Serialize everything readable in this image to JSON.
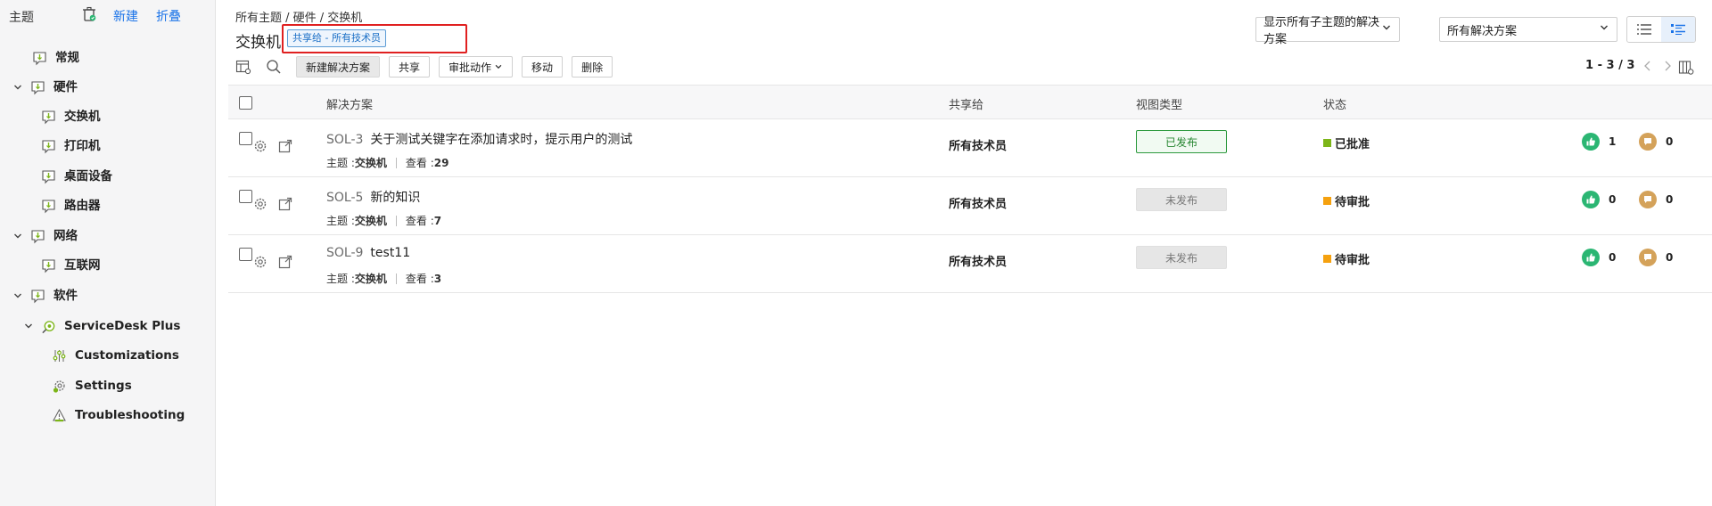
{
  "sidebar": {
    "title": "主题",
    "new_label": "新建",
    "collapse_label": "折叠",
    "items": [
      {
        "label": "常规"
      },
      {
        "label": "硬件"
      },
      {
        "label": "交换机"
      },
      {
        "label": "打印机"
      },
      {
        "label": "桌面设备"
      },
      {
        "label": "路由器"
      },
      {
        "label": "网络"
      },
      {
        "label": "互联网"
      },
      {
        "label": "软件"
      },
      {
        "label": "ServiceDesk Plus"
      },
      {
        "label": "Customizations"
      },
      {
        "label": "Settings"
      },
      {
        "label": "Troubleshooting"
      }
    ]
  },
  "header": {
    "breadcrumb": "所有主题 / 硬件 / 交换机",
    "title": "交换机",
    "shared_badge": "共享给 - 所有技术员",
    "subtopic_filter": "显示所有子主题的解决方案",
    "solution_filter": "所有解决方案"
  },
  "toolbar": {
    "new_solution": "新建解决方案",
    "share": "共享",
    "approval_actions": "审批动作",
    "move": "移动",
    "delete": "删除",
    "pagination": "1 - 3 / 3"
  },
  "table": {
    "headers": {
      "solution": "解决方案",
      "shared_with": "共享给",
      "view_type": "视图类型",
      "status": "状态"
    },
    "rows": [
      {
        "id": "SOL-3",
        "title": "关于测试关键字在添加请求时，提示用户的测试",
        "topic_label": "主题 : ",
        "topic": "交换机",
        "views_label": "查看 : ",
        "views": "29",
        "shared_with": "所有技术员",
        "view_type": "已发布",
        "status": "已批准",
        "likes": "1",
        "comments": "0"
      },
      {
        "id": "SOL-5",
        "title": "新的知识",
        "topic_label": "主题 : ",
        "topic": "交换机",
        "views_label": "查看 : ",
        "views": "7",
        "shared_with": "所有技术员",
        "view_type": "未发布",
        "status": "待审批",
        "likes": "0",
        "comments": "0"
      },
      {
        "id": "SOL-9",
        "title": "test11",
        "topic_label": "主题 : ",
        "topic": "交换机",
        "views_label": "查看 : ",
        "views": "3",
        "shared_with": "所有技术员",
        "view_type": "未发布",
        "status": "待审批",
        "likes": "0",
        "comments": "0"
      }
    ]
  },
  "colors": {
    "link_blue": "#1a73e8",
    "approved": "#7cb518",
    "pending": "#f5a10f",
    "like": "#2bb673",
    "comment": "#d4a25a",
    "highlight": "#e02020"
  }
}
